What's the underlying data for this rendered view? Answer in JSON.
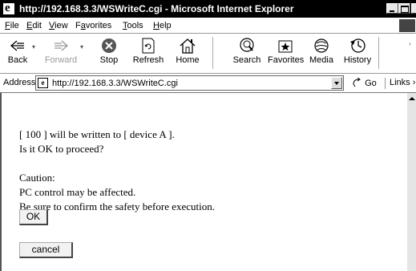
{
  "window": {
    "title": "http://192.168.3.3/WSWriteC.cgi - Microsoft Internet Explorer"
  },
  "menu": {
    "items": [
      {
        "label": "File",
        "accel": "F",
        "rest": "ile"
      },
      {
        "label": "Edit",
        "accel": "E",
        "rest": "dit"
      },
      {
        "label": "View",
        "accel": "V",
        "rest": "iew"
      },
      {
        "label": "Favorites",
        "pre": "F",
        "accel": "a",
        "rest": "vorites"
      },
      {
        "label": "Tools",
        "accel": "T",
        "rest": "ools"
      },
      {
        "label": "Help",
        "accel": "H",
        "rest": "elp"
      }
    ]
  },
  "toolbar": {
    "back": "Back",
    "forward": "Forward",
    "stop": "Stop",
    "refresh": "Refresh",
    "home": "Home",
    "search": "Search",
    "favorites": "Favorites",
    "media": "Media",
    "history": "History"
  },
  "address": {
    "label": "Address",
    "url": "http://192.168.3.3/WSWriteC.cgi",
    "go": "Go",
    "links": "Links"
  },
  "page": {
    "line1": "[ 100 ] will be written to [ device A ].",
    "line2": "Is it OK to proceed?",
    "caution_title": "Caution:",
    "caution1": "PC control may be affected.",
    "caution2": "Be sure to confirm the safety before execution.",
    "ok_label": "OK",
    "cancel_label": "cancel"
  }
}
